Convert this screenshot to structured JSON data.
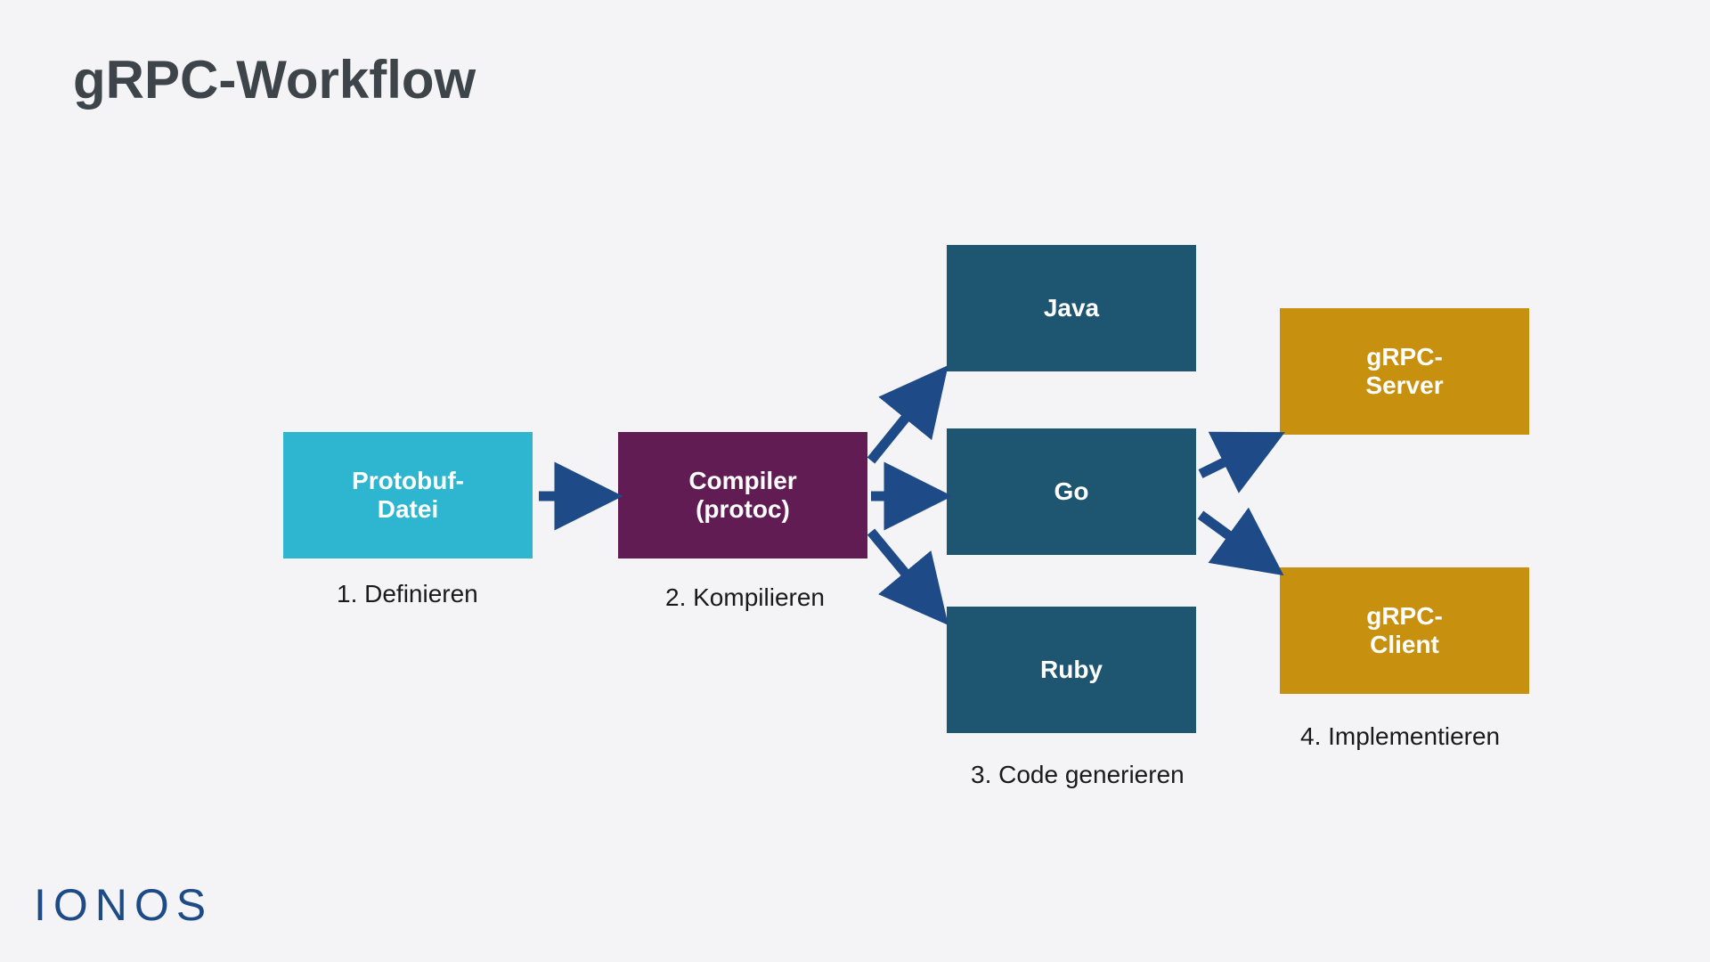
{
  "title": "gRPC-Workflow",
  "boxes": {
    "protobuf": "Protobuf-\nDatei",
    "compiler": "Compiler\n(protoc)",
    "java": "Java",
    "go": "Go",
    "ruby": "Ruby",
    "server": "gRPC-\nServer",
    "client": "gRPC-\nClient"
  },
  "steps": {
    "s1": "1. Definieren",
    "s2": "2. Kompilieren",
    "s3": "3. Code generieren",
    "s4": "4. Implementieren"
  },
  "logo": "IONOS",
  "colors": {
    "cyan": "#2eb6d0",
    "purple": "#611d53",
    "teal": "#1e5570",
    "gold": "#c7900e",
    "arrow": "#1e4b87"
  }
}
